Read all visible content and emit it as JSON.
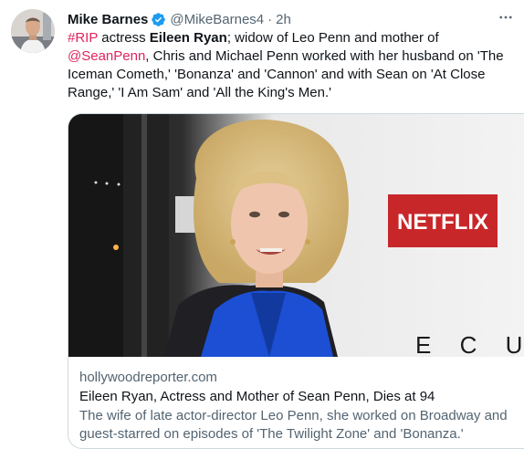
{
  "author": {
    "name": "Mike Barnes",
    "handle": "@MikeBarnes4",
    "separator": "·",
    "time": "2h"
  },
  "tweet": {
    "hashtag": "#RIP",
    "t1": " actress ",
    "bold_name": "Eileen Ryan",
    "t2": "; widow of Leo Penn and mother of ",
    "mention": "@SeanPenn",
    "t3": ", Chris and Michael Penn worked with her husband on 'The Iceman Cometh,' 'Bonanza' and 'Cannon' and with Sean on 'At Close Range,' 'I Am Sam' and 'All the King's Men.'"
  },
  "card": {
    "logo_text": "NETFLIX",
    "backdrop_text": "E C U",
    "domain": "hollywoodreporter.com",
    "title": "Eileen Ryan, Actress and Mother of Sean Penn, Dies at 94",
    "description": "The wife of late actor-director Leo Penn, she worked on Broadway and guest-starred on episodes of 'The Twilight Zone' and 'Bonanza.'"
  },
  "colors": {
    "link": "#e0245e",
    "verified": "#1d9bf0",
    "netflix_red": "#c8272a",
    "blouse": "#1c4fd4"
  },
  "icons": {
    "verified": "verified-badge-icon",
    "more": "more-icon"
  }
}
